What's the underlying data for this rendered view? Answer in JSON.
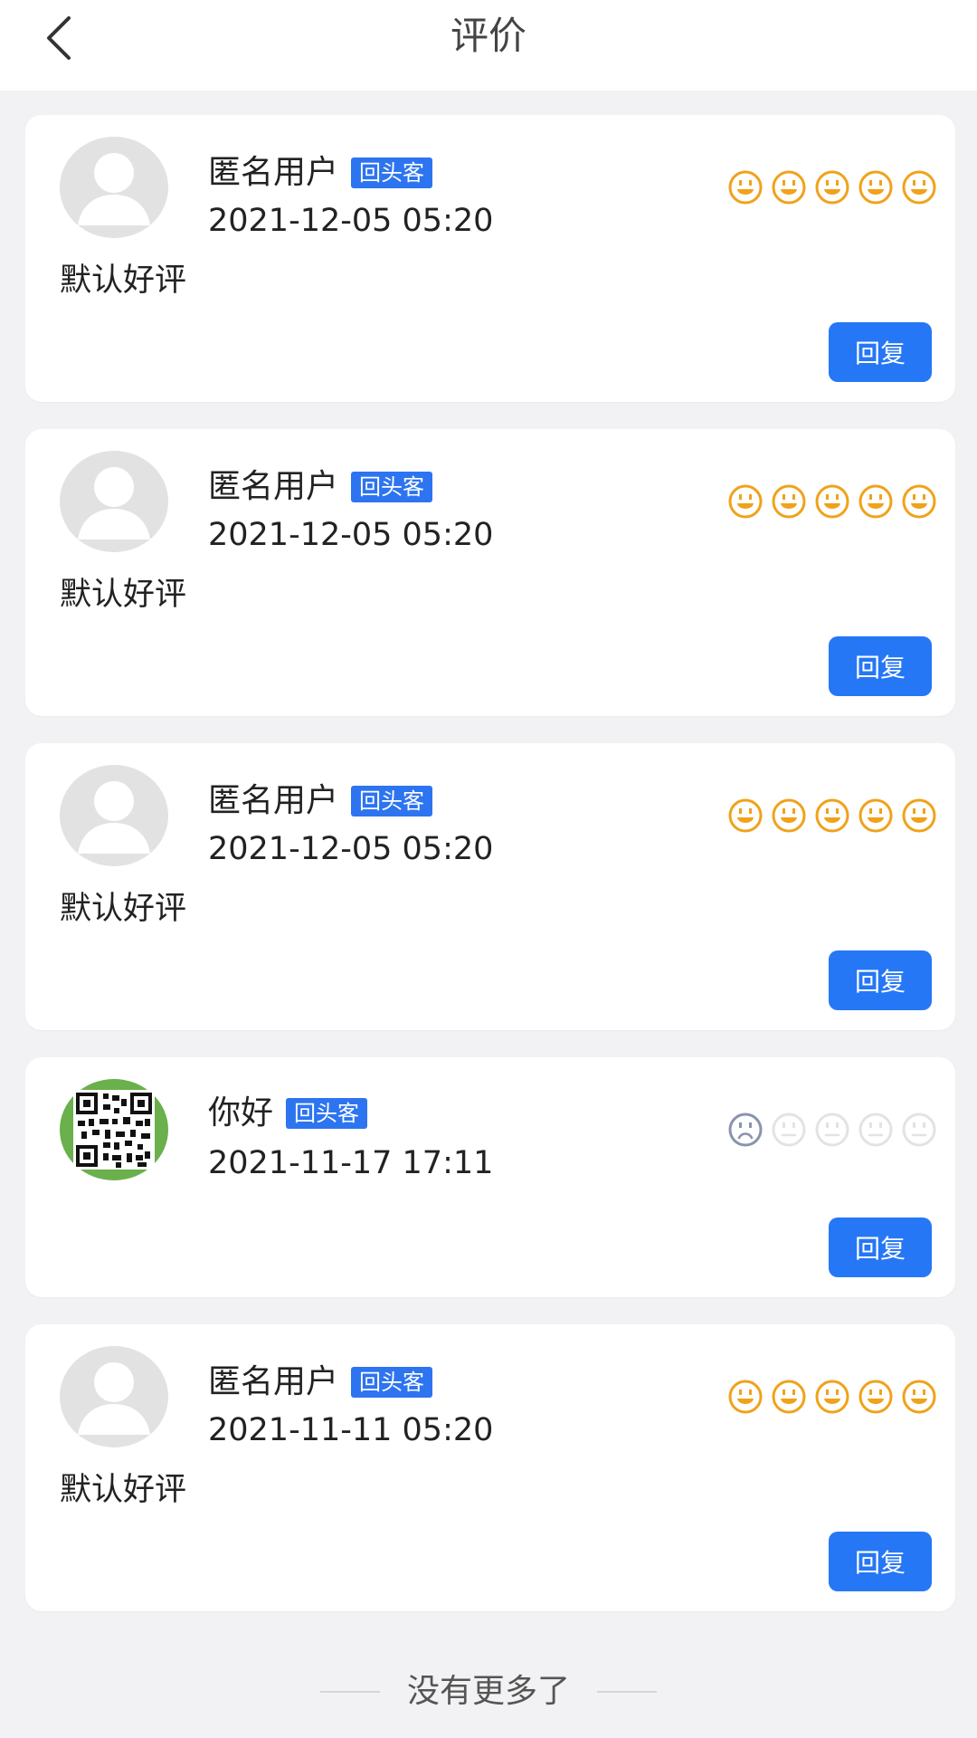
{
  "header": {
    "title": "评价",
    "back_icon": "chevron-left-icon"
  },
  "colors": {
    "accent": "#2677f6",
    "badge": "#2d74f0",
    "happy_face": "#f0a21a",
    "sad_face_active": "#8a93ad",
    "face_inactive": "#e3e3e3"
  },
  "reviews": [
    {
      "avatar": "default-avatar",
      "name": "匿名用户",
      "badge": "回头客",
      "date": "2021-12-05 05:20",
      "rating": 5,
      "text": "默认好评",
      "reply_label": "回复"
    },
    {
      "avatar": "default-avatar",
      "name": "匿名用户",
      "badge": "回头客",
      "date": "2021-12-05 05:20",
      "rating": 5,
      "text": "默认好评",
      "reply_label": "回复"
    },
    {
      "avatar": "default-avatar",
      "name": "匿名用户",
      "badge": "回头客",
      "date": "2021-12-05 05:20",
      "rating": 5,
      "text": "默认好评",
      "reply_label": "回复"
    },
    {
      "avatar": "qr-code-avatar",
      "name": "你好",
      "badge": "回头客",
      "date": "2021-11-17 17:11",
      "rating": 1,
      "text": "",
      "reply_label": "回复"
    },
    {
      "avatar": "default-avatar",
      "name": "匿名用户",
      "badge": "回头客",
      "date": "2021-11-11 05:20",
      "rating": 5,
      "text": "默认好评",
      "reply_label": "回复"
    }
  ],
  "footer": {
    "text": "没有更多了"
  }
}
